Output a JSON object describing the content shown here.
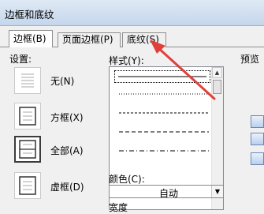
{
  "window": {
    "title": "边框和底纹"
  },
  "tabs": [
    {
      "label": "边框(B)"
    },
    {
      "label": "页面边框(P)"
    },
    {
      "label": "底纹(S)"
    }
  ],
  "settings": {
    "label": "设置:",
    "options": [
      {
        "label": "无(N)",
        "icon": "border-none-icon"
      },
      {
        "label": "方框(X)",
        "icon": "border-box-icon"
      },
      {
        "label": "全部(A)",
        "icon": "border-all-icon",
        "selected": true
      },
      {
        "label": "虚框(D)",
        "icon": "border-grid-icon"
      }
    ]
  },
  "style": {
    "label": "样式(Y):",
    "items": [
      "solid",
      "dotted",
      "dashed-small",
      "dashed",
      "dash-dot"
    ]
  },
  "color": {
    "label": "颜色(C):",
    "value": "自动"
  },
  "width": {
    "label": "宽度"
  },
  "preview": {
    "label": "预览"
  },
  "annotation": {
    "arrow_color": "#e0403a"
  }
}
